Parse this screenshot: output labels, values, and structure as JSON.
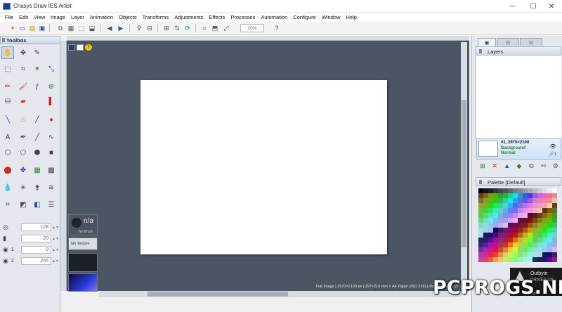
{
  "window": {
    "title": "Chasys Draw IES Artist",
    "minimize": "─",
    "maximize": "☐",
    "close": "✕"
  },
  "menu": [
    "File",
    "Edit",
    "View",
    "Image",
    "Layer",
    "Animation",
    "Objects",
    "Transforms",
    "Adjustments",
    "Effects",
    "Processes",
    "Automation",
    "Configure",
    "Window",
    "Help"
  ],
  "toolbar": {
    "zoom": "20%"
  },
  "toolbox": {
    "title": "Toolbox",
    "props": [
      {
        "icon": "◎",
        "label": "",
        "value": "128"
      },
      {
        "icon": "▮",
        "label": "",
        "value": "20"
      },
      {
        "icon": "◉",
        "label": "1",
        "value": "0"
      },
      {
        "icon": "◉",
        "label": "2",
        "value": "255"
      }
    ]
  },
  "brush": {
    "brush_label": "n/a",
    "brush_sub": "No Brush",
    "texture_label": "No Texture"
  },
  "status": {
    "text": "Flat Image | 2970×2100 px | 297×210 mm = A4 Paper (ISO 216) | x/y = 17.12 | 6.27"
  },
  "layers": {
    "title": "Layers",
    "layer_name": "#1, 2970×2100",
    "layer_sub": "Background",
    "layer_mode": "Normal",
    "layer_count": "1"
  },
  "palette": {
    "title": "Palette [Default]"
  },
  "notification": {
    "title": "Outbyte",
    "subtitle": "DRIVER UP",
    "tail": "ew"
  },
  "watermark": "PCPROGS.NET",
  "colors": {
    "canvas_bg": "#4b5563",
    "panel_bg": "#e4e8ee",
    "layer_green": "#2c7d2c"
  }
}
